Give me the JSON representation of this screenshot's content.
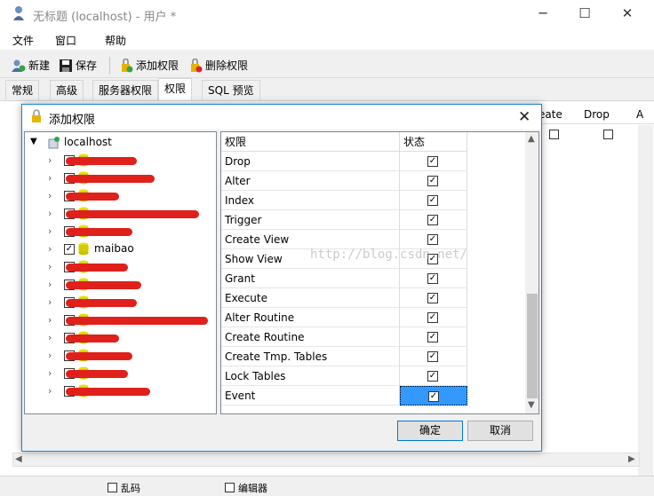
{
  "window": {
    "title": "无标题 (localhost) - 用户 *",
    "minimize": "─",
    "maximize": "☐",
    "close": "✕"
  },
  "menu": {
    "file": "文件",
    "window": "窗口",
    "help": "帮助"
  },
  "toolbar": {
    "new": "新建",
    "save": "保存",
    "add_priv": "添加权限",
    "del_priv": "删除权限"
  },
  "tabs": [
    "常规",
    "高级",
    "服务器权限",
    "权限",
    "SQL 预览"
  ],
  "background_grid": {
    "col_create": "eate",
    "col_drop": "Drop",
    "col_a": "A"
  },
  "bottom_strip": {
    "left": "乱码",
    "right": "编辑器"
  },
  "dialog": {
    "title": "添加权限",
    "close": "✕",
    "tree": {
      "root": "localhost",
      "items": [
        {
          "label": "",
          "checked": false
        },
        {
          "label": "",
          "checked": false
        },
        {
          "label": "",
          "checked": false
        },
        {
          "label": "",
          "checked": false
        },
        {
          "label": "",
          "checked": false
        },
        {
          "label": "maibao",
          "checked": true
        },
        {
          "label": "",
          "checked": false
        },
        {
          "label": "",
          "checked": false
        },
        {
          "label": "",
          "checked": false
        },
        {
          "label": "",
          "checked": false
        },
        {
          "label": "",
          "checked": false
        },
        {
          "label": "",
          "checked": false
        },
        {
          "label": "",
          "checked": false
        },
        {
          "label": "",
          "checked": false
        }
      ]
    },
    "grid": {
      "col_priv": "权限",
      "col_status": "状态",
      "rows": [
        {
          "name": "Drop",
          "checked": true
        },
        {
          "name": "Alter",
          "checked": true
        },
        {
          "name": "Index",
          "checked": true
        },
        {
          "name": "Trigger",
          "checked": true
        },
        {
          "name": "Create View",
          "checked": true
        },
        {
          "name": "Show View",
          "checked": true
        },
        {
          "name": "Grant",
          "checked": true
        },
        {
          "name": "Execute",
          "checked": true
        },
        {
          "name": "Alter Routine",
          "checked": true
        },
        {
          "name": "Create Routine",
          "checked": true
        },
        {
          "name": "Create Tmp. Tables",
          "checked": true
        },
        {
          "name": "Lock Tables",
          "checked": true
        },
        {
          "name": "Event",
          "checked": true
        }
      ],
      "selected_row": "Event"
    },
    "ok": "确定",
    "cancel": "取消",
    "watermark": "http://blog.csdn.net/"
  },
  "colors": {
    "accent": "#0078d7",
    "selection": "#3399ff",
    "redaction": "#e0201b"
  }
}
